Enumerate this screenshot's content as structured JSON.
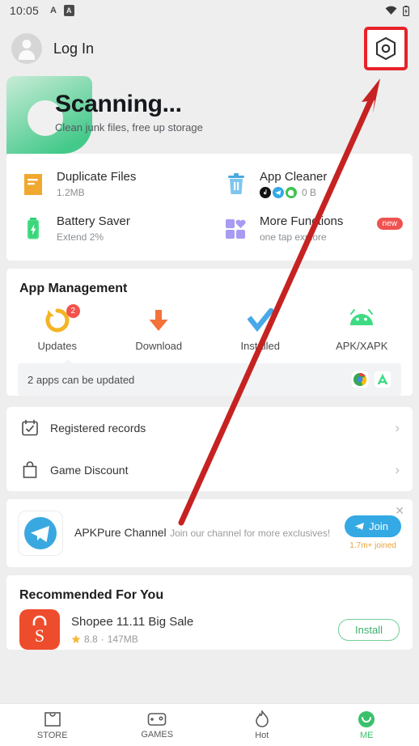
{
  "status_bar": {
    "time": "10:05",
    "left_icons": [
      "app-notification-icon",
      "app-notification-boxed-icon"
    ],
    "right_icons": [
      "wifi-icon",
      "battery-icon"
    ],
    "icon_letter": "A"
  },
  "header": {
    "login_label": "Log In",
    "settings_icon": "hexagon-gear-icon",
    "highlight_color": "#e8222a"
  },
  "banner": {
    "title": "Scanning...",
    "subtitle": "Clean junk files, free up storage",
    "accent_color": "#4ecb8d"
  },
  "tiles": [
    {
      "title": "Duplicate Files",
      "subtitle": "1.2MB",
      "icon": "document-stack-icon",
      "icon_color": "#f5a623",
      "badge": "",
      "mini_icons": []
    },
    {
      "title": "App Cleaner",
      "subtitle": "0 B",
      "icon": "trash-can-icon",
      "icon_color": "#4aa8e0",
      "badge": "",
      "mini_icons": [
        "tiktok-icon",
        "telegram-icon",
        "whatsapp-icon"
      ]
    },
    {
      "title": "Battery Saver",
      "subtitle": "Extend 2%",
      "icon": "battery-bolt-icon",
      "icon_color": "#2ecc71",
      "badge": "",
      "mini_icons": []
    },
    {
      "title": "More Functions",
      "subtitle": "one tap explore",
      "icon": "grid-heart-icon",
      "icon_color": "#9b8df0",
      "badge": "new",
      "mini_icons": []
    }
  ],
  "app_management": {
    "title": "App Management",
    "tabs": [
      {
        "label": "Updates",
        "icon": "refresh-circle-icon",
        "badge": "2"
      },
      {
        "label": "Download",
        "icon": "download-arrow-icon",
        "badge": ""
      },
      {
        "label": "Installed",
        "icon": "check-mark-icon",
        "badge": ""
      },
      {
        "label": "APK/XAPK",
        "icon": "android-robot-icon",
        "badge": ""
      }
    ],
    "update_notice": "2 apps can be updated",
    "update_apps": [
      "chrome-icon",
      "apkpure-icon"
    ]
  },
  "menu_rows": [
    {
      "label": "Registered records",
      "icon": "calendar-check-icon"
    },
    {
      "label": "Game Discount",
      "icon": "shopping-bag-icon"
    }
  ],
  "channel_card": {
    "title": "APKPure Channel",
    "subtitle": "Join our channel for more exclusives!",
    "join_label": "Join",
    "joined_count": "1.7m+ joined",
    "icon": "telegram-icon",
    "close_icon": "close-icon",
    "button_color": "#34a9e4"
  },
  "recommended": {
    "title": "Recommended For You",
    "apps": [
      {
        "name": "Shopee 11.11 Big Sale",
        "rating": "8.8",
        "size": "147MB",
        "install_label": "Install",
        "icon": "shopee-icon"
      }
    ]
  },
  "bottom_nav": [
    {
      "label": "STORE",
      "icon": "store-bag-icon",
      "active": false
    },
    {
      "label": "GAMES",
      "icon": "gamepad-icon",
      "active": false
    },
    {
      "label": "Hot",
      "icon": "flame-icon",
      "active": false
    },
    {
      "label": "ME",
      "icon": "profile-circle-icon",
      "active": true
    }
  ],
  "annotation": {
    "type": "arrow",
    "color": "#c62222",
    "points_to": "settings-button"
  }
}
